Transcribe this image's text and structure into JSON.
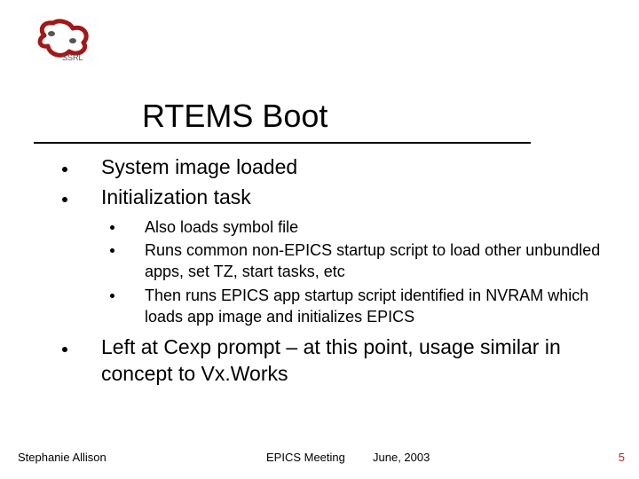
{
  "logo": {
    "label_top": "SSRL"
  },
  "title": "RTEMS Boot",
  "points": [
    {
      "text": "System image loaded"
    },
    {
      "text": "Initialization task"
    }
  ],
  "subpoints": [
    {
      "text": "Also loads symbol file"
    },
    {
      "text": "Runs common non-EPICS startup script to load other unbundled apps, set TZ, start tasks, etc"
    },
    {
      "text": "Then runs EPICS app startup script identified in NVRAM which loads app image and initializes EPICS"
    }
  ],
  "point3": {
    "text": "Left at Cexp prompt – at this point, usage similar in concept to Vx.Works"
  },
  "footer": {
    "author": "Stephanie Allison",
    "event": "EPICS Meeting",
    "date": "June, 2003",
    "page": "5"
  }
}
